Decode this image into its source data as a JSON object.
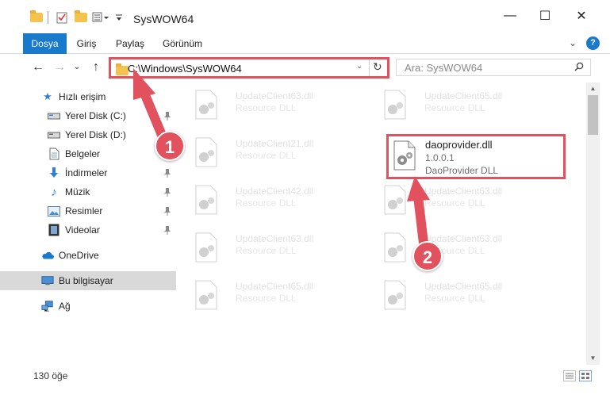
{
  "window": {
    "title": "SysWOW64",
    "minimize_glyph": "—",
    "maximize_glyph": "☐",
    "close_glyph": "✕"
  },
  "ribbon": {
    "tabs": [
      {
        "label": "Dosya"
      },
      {
        "label": "Giriş"
      },
      {
        "label": "Paylaş"
      },
      {
        "label": "Görünüm"
      }
    ],
    "expand_glyph": "⌄",
    "help_label": "?"
  },
  "navigation": {
    "back_glyph": "←",
    "forward_glyph": "→",
    "recent_glyph": "⌄",
    "up_glyph": "↑"
  },
  "address": {
    "path": "C:\\Windows\\SysWOW64",
    "dropdown_glyph": "⌄",
    "refresh_glyph": "↻"
  },
  "search": {
    "placeholder": "Ara: SysWOW64"
  },
  "sidebar": {
    "items": [
      {
        "label": "Hızlı erişim",
        "icon": "star-icon"
      },
      {
        "label": "Yerel Disk (C:)",
        "icon": "drive-icon"
      },
      {
        "label": "Yerel Disk (D:)",
        "icon": "drive-icon"
      },
      {
        "label": "Belgeler",
        "icon": "document-icon"
      },
      {
        "label": "İndirmeler",
        "icon": "download-icon"
      },
      {
        "label": "Müzik",
        "icon": "music-icon"
      },
      {
        "label": "Resimler",
        "icon": "picture-icon"
      },
      {
        "label": "Videolar",
        "icon": "video-icon"
      },
      {
        "label": "OneDrive",
        "icon": "cloud-icon"
      },
      {
        "label": "Bu bilgisayar",
        "icon": "computer-icon"
      },
      {
        "label": "Ağ",
        "icon": "network-icon"
      }
    ]
  },
  "files": [
    {
      "name": "UpdateClient63.dll",
      "desc": "Resource DLL"
    },
    {
      "name": "UpdateClient65.dll",
      "desc": "Resource DLL"
    },
    {
      "name": "UpdateClient21.dll",
      "desc": "Resource DLL"
    },
    {
      "name": "UpdateClient42.dll",
      "desc": "Resource DLL"
    },
    {
      "name": "UpdateClient63.dll",
      "desc": "Resource DLL"
    },
    {
      "name": "UpdateClient63.dll",
      "desc": "Resource DLL"
    },
    {
      "name": "UpdateClient63.dll",
      "desc": "Resource DLL"
    },
    {
      "name": "UpdateClient65.dll",
      "desc": "Resource DLL"
    },
    {
      "name": "UpdateClient65.dll",
      "desc": "Resource DLL"
    }
  ],
  "highlighted_file": {
    "name": "daoprovider.dll",
    "version": "1.0.0.1",
    "desc": "DaoProvider DLL"
  },
  "status": {
    "item_count": "130 öğe"
  },
  "annotations": {
    "step1": "1",
    "step2": "2"
  },
  "colors": {
    "accent": "#1979ca",
    "annotation_red": "#e2515e",
    "folder_yellow": "#f4c34f"
  }
}
